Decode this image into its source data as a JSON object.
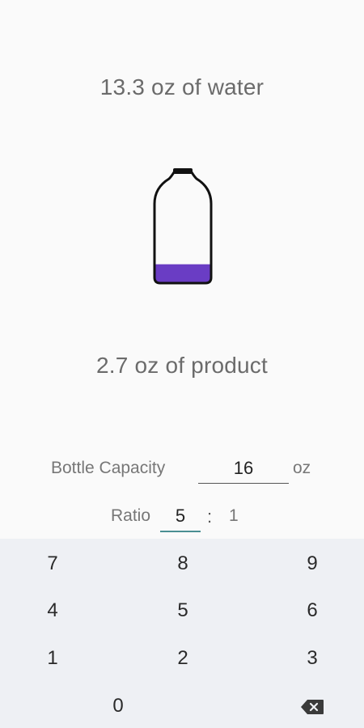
{
  "water": {
    "text": "13.3 oz of water"
  },
  "product": {
    "text": "2.7 oz of product"
  },
  "bottle": {
    "fill_fraction": 0.17,
    "fill_color": "#6a3dc4",
    "outline_color": "#111111"
  },
  "capacity": {
    "label": "Bottle Capacity",
    "value": "16",
    "unit": "oz"
  },
  "ratio": {
    "label": "Ratio",
    "value": "5",
    "separator": ":",
    "second": "1"
  },
  "keyboard": {
    "keys": [
      "7",
      "8",
      "9",
      "4",
      "5",
      "6",
      "1",
      "2",
      "3",
      "0"
    ],
    "backspace_icon": "backspace-icon"
  }
}
